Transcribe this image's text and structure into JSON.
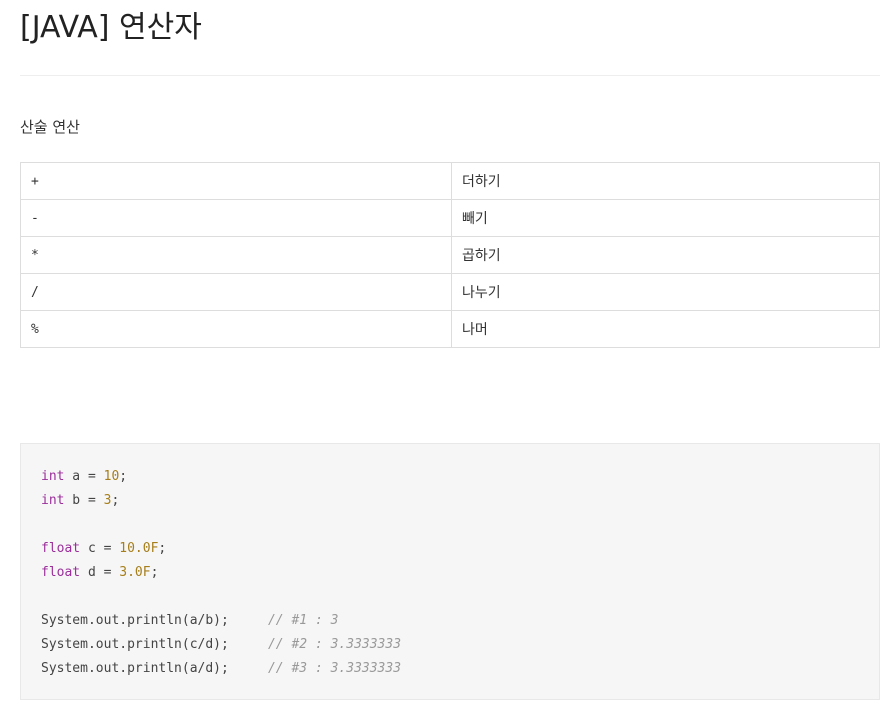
{
  "post": {
    "title": "[JAVA] 연산자"
  },
  "section": {
    "heading": "산술 연산"
  },
  "operators": [
    {
      "symbol": "+",
      "meaning": "더하기"
    },
    {
      "symbol": "-",
      "meaning": "빼기"
    },
    {
      "symbol": "*",
      "meaning": "곱하기"
    },
    {
      "symbol": "/",
      "meaning": "나누기"
    },
    {
      "symbol": "%",
      "meaning": "나머"
    }
  ],
  "code": {
    "line1": {
      "kw": "int",
      "mid": " a = ",
      "num": "10",
      "end": ";"
    },
    "line2": {
      "kw": "int",
      "mid": " b = ",
      "num": "3",
      "end": ";"
    },
    "line3": {
      "kw": "float",
      "mid": " c = ",
      "num": "10.0F",
      "end": ";"
    },
    "line4": {
      "kw": "float",
      "mid": " d = ",
      "num": "3.0F",
      "end": ";"
    },
    "line5": {
      "stmt": "System.out.println(a/b);     ",
      "comment": "// #1 : 3"
    },
    "line6": {
      "stmt": "System.out.println(c/d);     ",
      "comment": "// #2 : 3.3333333"
    },
    "line7": {
      "stmt": "System.out.println(a/d);     ",
      "comment": "// #3 : 3.3333333"
    }
  },
  "colors": {
    "keyword": "#9a2f9a",
    "number": "#a67f1c",
    "comment": "#999999",
    "code_background": "#f6f6f6"
  }
}
